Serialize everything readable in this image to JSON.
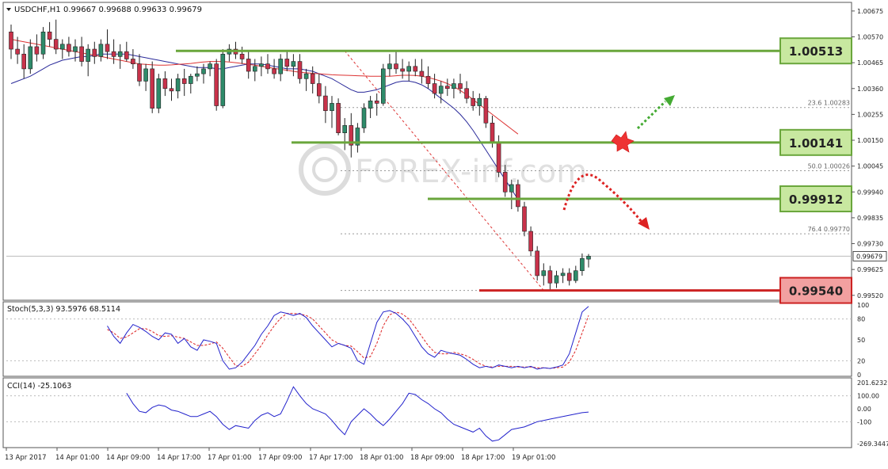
{
  "chart_header": {
    "symbol": "USDCHF,H1",
    "ohlc": "0.99667 0.99688 0.99633 0.99679"
  },
  "watermark": "FOREX-inf.com",
  "levels": [
    {
      "label": "1.00513",
      "value": 1.00513,
      "color": "#6aa63c",
      "fill": "#c8e8a0"
    },
    {
      "label": "1.00141",
      "value": 1.00141,
      "color": "#6aa63c",
      "fill": "#c8e8a0"
    },
    {
      "label": "0.99912",
      "value": 0.99912,
      "color": "#6aa63c",
      "fill": "#c8e8a0"
    },
    {
      "label": "0.99540",
      "value": 0.9954,
      "color": "#cc2222",
      "fill": "#f2a0a0"
    }
  ],
  "fib_labels": [
    {
      "text": "23.6  1.00283",
      "value": 1.00283
    },
    {
      "text": "50.0  1.00026",
      "value": 1.00026
    },
    {
      "text": "76.4  0.99770",
      "value": 0.9977
    }
  ],
  "price_axis": {
    "ticks": [
      "1.00675",
      "1.00570",
      "1.00465",
      "1.00360",
      "1.00255",
      "1.00150",
      "1.00045",
      "0.99940",
      "0.99835",
      "0.99730",
      "0.99625",
      "0.99520"
    ],
    "current": "0.99679"
  },
  "stoch": {
    "label": "Stoch(5,3,3) 93.5976 68.5114",
    "ticks": [
      "100",
      "80",
      "50",
      "20",
      "0"
    ]
  },
  "cci": {
    "label": "CCI(14) -25.1063",
    "ticks": [
      "201.6232",
      "100.00",
      "0.00",
      "-100",
      "-269.3447"
    ]
  },
  "time_axis": [
    "13 Apr 2017",
    "14 Apr 01:00",
    "14 Apr 09:00",
    "14 Apr 17:00",
    "17 Apr 01:00",
    "17 Apr 09:00",
    "17 Apr 17:00",
    "18 Apr 01:00",
    "18 Apr 09:00",
    "18 Apr 17:00",
    "19 Apr 01:00"
  ],
  "colors": {
    "bull": "#2e8b6a",
    "bear": "#c8324a",
    "ma_fast": "#2a2a9a",
    "ma_slow": "#dd3333",
    "stoch_main": "#2222cc",
    "stoch_signal": "#dd2222",
    "cci_line": "#2222cc",
    "arrow_up": "#44aa33",
    "arrow_down": "#dd2222"
  },
  "chart_data": {
    "type": "candlestick",
    "title": "USDCHF,H1",
    "ylim": [
      0.995,
      1.0071
    ],
    "candles": [
      {
        "o": 1.0059,
        "h": 1.0062,
        "l": 1.0048,
        "c": 1.0052
      },
      {
        "o": 1.0052,
        "h": 1.0057,
        "l": 1.0046,
        "c": 1.005
      },
      {
        "o": 1.005,
        "h": 1.0054,
        "l": 1.004,
        "c": 1.0044
      },
      {
        "o": 1.0044,
        "h": 1.0056,
        "l": 1.0042,
        "c": 1.0053
      },
      {
        "o": 1.0053,
        "h": 1.0058,
        "l": 1.0047,
        "c": 1.005
      },
      {
        "o": 1.005,
        "h": 1.0061,
        "l": 1.0048,
        "c": 1.0059
      },
      {
        "o": 1.0059,
        "h": 1.0063,
        "l": 1.0053,
        "c": 1.0056
      },
      {
        "o": 1.0056,
        "h": 1.0064,
        "l": 1.005,
        "c": 1.0052
      },
      {
        "o": 1.0052,
        "h": 1.0056,
        "l": 1.0048,
        "c": 1.0054
      },
      {
        "o": 1.0054,
        "h": 1.0057,
        "l": 1.0049,
        "c": 1.0051
      },
      {
        "o": 1.0051,
        "h": 1.0056,
        "l": 1.0047,
        "c": 1.0053
      },
      {
        "o": 1.0053,
        "h": 1.0057,
        "l": 1.0045,
        "c": 1.0047
      },
      {
        "o": 1.0047,
        "h": 1.0054,
        "l": 1.0041,
        "c": 1.0052
      },
      {
        "o": 1.0052,
        "h": 1.0055,
        "l": 1.0046,
        "c": 1.0049
      },
      {
        "o": 1.0049,
        "h": 1.0056,
        "l": 1.0047,
        "c": 1.0054
      },
      {
        "o": 1.0054,
        "h": 1.006,
        "l": 1.0048,
        "c": 1.0051
      },
      {
        "o": 1.0051,
        "h": 1.0056,
        "l": 1.0046,
        "c": 1.0049
      },
      {
        "o": 1.0049,
        "h": 1.0054,
        "l": 1.0044,
        "c": 1.0051
      },
      {
        "o": 1.0051,
        "h": 1.0055,
        "l": 1.0047,
        "c": 1.0048
      },
      {
        "o": 1.0048,
        "h": 1.0052,
        "l": 1.0044,
        "c": 1.0046
      },
      {
        "o": 1.0046,
        "h": 1.005,
        "l": 1.0037,
        "c": 1.0039
      },
      {
        "o": 1.0039,
        "h": 1.0046,
        "l": 1.0035,
        "c": 1.0044
      },
      {
        "o": 1.0044,
        "h": 1.0047,
        "l": 1.0026,
        "c": 1.0028
      },
      {
        "o": 1.0028,
        "h": 1.0042,
        "l": 1.0026,
        "c": 1.004
      },
      {
        "o": 1.004,
        "h": 1.0043,
        "l": 1.0033,
        "c": 1.0036
      },
      {
        "o": 1.0036,
        "h": 1.004,
        "l": 1.0031,
        "c": 1.0035
      },
      {
        "o": 1.0035,
        "h": 1.0042,
        "l": 1.0032,
        "c": 1.004
      },
      {
        "o": 1.004,
        "h": 1.0044,
        "l": 1.0033,
        "c": 1.0038
      },
      {
        "o": 1.0038,
        "h": 1.0042,
        "l": 1.0034,
        "c": 1.0041
      },
      {
        "o": 1.0041,
        "h": 1.0045,
        "l": 1.0039,
        "c": 1.0042
      },
      {
        "o": 1.0042,
        "h": 1.0046,
        "l": 1.0038,
        "c": 1.0044
      },
      {
        "o": 1.0044,
        "h": 1.0047,
        "l": 1.0041,
        "c": 1.0046
      },
      {
        "o": 1.0046,
        "h": 1.0048,
        "l": 1.0027,
        "c": 1.0029
      },
      {
        "o": 1.0029,
        "h": 1.0052,
        "l": 1.0028,
        "c": 1.005
      },
      {
        "o": 1.005,
        "h": 1.0054,
        "l": 1.0047,
        "c": 1.0052
      },
      {
        "o": 1.0052,
        "h": 1.0055,
        "l": 1.0048,
        "c": 1.005
      },
      {
        "o": 1.005,
        "h": 1.0053,
        "l": 1.0046,
        "c": 1.0048
      },
      {
        "o": 1.0048,
        "h": 1.0051,
        "l": 1.004,
        "c": 1.0043
      },
      {
        "o": 1.0043,
        "h": 1.0048,
        "l": 1.0039,
        "c": 1.0045
      },
      {
        "o": 1.0045,
        "h": 1.0049,
        "l": 1.0041,
        "c": 1.0046
      },
      {
        "o": 1.0046,
        "h": 1.005,
        "l": 1.0042,
        "c": 1.0044
      },
      {
        "o": 1.0044,
        "h": 1.0048,
        "l": 1.004,
        "c": 1.0042
      },
      {
        "o": 1.0042,
        "h": 1.005,
        "l": 1.0039,
        "c": 1.0048
      },
      {
        "o": 1.0048,
        "h": 1.0051,
        "l": 1.0043,
        "c": 1.0045
      },
      {
        "o": 1.0045,
        "h": 1.005,
        "l": 1.0041,
        "c": 1.0047
      },
      {
        "o": 1.0047,
        "h": 1.005,
        "l": 1.0038,
        "c": 1.004
      },
      {
        "o": 1.004,
        "h": 1.0044,
        "l": 1.0035,
        "c": 1.0042
      },
      {
        "o": 1.0042,
        "h": 1.0045,
        "l": 1.0034,
        "c": 1.0038
      },
      {
        "o": 1.0038,
        "h": 1.0042,
        "l": 1.003,
        "c": 1.0033
      },
      {
        "o": 1.0033,
        "h": 1.0037,
        "l": 1.0022,
        "c": 1.0027
      },
      {
        "o": 1.0027,
        "h": 1.0033,
        "l": 1.002,
        "c": 1.003
      },
      {
        "o": 1.003,
        "h": 1.0032,
        "l": 1.0017,
        "c": 1.0018
      },
      {
        "o": 1.0018,
        "h": 1.0024,
        "l": 1.0011,
        "c": 1.0021
      },
      {
        "o": 1.0021,
        "h": 1.0026,
        "l": 1.0008,
        "c": 1.0013
      },
      {
        "o": 1.0013,
        "h": 1.0022,
        "l": 1.001,
        "c": 1.002
      },
      {
        "o": 1.002,
        "h": 1.003,
        "l": 1.0018,
        "c": 1.0028
      },
      {
        "o": 1.0028,
        "h": 1.0033,
        "l": 1.0024,
        "c": 1.0031
      },
      {
        "o": 1.0031,
        "h": 1.0034,
        "l": 1.0025,
        "c": 1.003
      },
      {
        "o": 1.003,
        "h": 1.0046,
        "l": 1.0029,
        "c": 1.0044
      },
      {
        "o": 1.0044,
        "h": 1.005,
        "l": 1.0041,
        "c": 1.0046
      },
      {
        "o": 1.0046,
        "h": 1.0051,
        "l": 1.0042,
        "c": 1.0044
      },
      {
        "o": 1.0044,
        "h": 1.0048,
        "l": 1.004,
        "c": 1.0043
      },
      {
        "o": 1.0043,
        "h": 1.0047,
        "l": 1.0039,
        "c": 1.0045
      },
      {
        "o": 1.0045,
        "h": 1.0048,
        "l": 1.0041,
        "c": 1.0043
      },
      {
        "o": 1.0043,
        "h": 1.0048,
        "l": 1.0038,
        "c": 1.0041
      },
      {
        "o": 1.0041,
        "h": 1.0045,
        "l": 1.0036,
        "c": 1.0038
      },
      {
        "o": 1.0038,
        "h": 1.0042,
        "l": 1.0032,
        "c": 1.0034
      },
      {
        "o": 1.0034,
        "h": 1.0039,
        "l": 1.003,
        "c": 1.0037
      },
      {
        "o": 1.0037,
        "h": 1.004,
        "l": 1.0033,
        "c": 1.0036
      },
      {
        "o": 1.0036,
        "h": 1.004,
        "l": 1.0032,
        "c": 1.0038
      },
      {
        "o": 1.0038,
        "h": 1.0042,
        "l": 1.0034,
        "c": 1.0036
      },
      {
        "o": 1.0036,
        "h": 1.0039,
        "l": 1.003,
        "c": 1.0032
      },
      {
        "o": 1.0032,
        "h": 1.0035,
        "l": 1.0027,
        "c": 1.0029
      },
      {
        "o": 1.0029,
        "h": 1.0034,
        "l": 1.0025,
        "c": 1.0032
      },
      {
        "o": 1.0032,
        "h": 1.0033,
        "l": 1.002,
        "c": 1.0022
      },
      {
        "o": 1.0022,
        "h": 1.0025,
        "l": 1.0012,
        "c": 1.0014
      },
      {
        "o": 1.0014,
        "h": 1.0017,
        "l": 1.0,
        "c": 1.0002
      },
      {
        "o": 1.0002,
        "h": 1.0005,
        "l": 0.9992,
        "c": 0.9994
      },
      {
        "o": 0.9994,
        "h": 0.9999,
        "l": 0.9987,
        "c": 0.9997
      },
      {
        "o": 0.9997,
        "h": 0.9999,
        "l": 0.9986,
        "c": 0.9988
      },
      {
        "o": 0.9988,
        "h": 0.999,
        "l": 0.9976,
        "c": 0.9978
      },
      {
        "o": 0.9978,
        "h": 0.998,
        "l": 0.9968,
        "c": 0.997
      },
      {
        "o": 0.997,
        "h": 0.9972,
        "l": 0.9958,
        "c": 0.996
      },
      {
        "o": 0.996,
        "h": 0.9965,
        "l": 0.9956,
        "c": 0.9962
      },
      {
        "o": 0.9962,
        "h": 0.9964,
        "l": 0.9954,
        "c": 0.9957
      },
      {
        "o": 0.9957,
        "h": 0.9962,
        "l": 0.9955,
        "c": 0.996
      },
      {
        "o": 0.996,
        "h": 0.9963,
        "l": 0.9957,
        "c": 0.9961
      },
      {
        "o": 0.9961,
        "h": 0.9963,
        "l": 0.9956,
        "c": 0.9958
      },
      {
        "o": 0.9958,
        "h": 0.9964,
        "l": 0.9957,
        "c": 0.9962
      },
      {
        "o": 0.9962,
        "h": 0.9969,
        "l": 0.996,
        "c": 0.9967
      },
      {
        "o": 0.99667,
        "h": 0.99688,
        "l": 0.99633,
        "c": 0.99679
      }
    ],
    "ma_fast": [
      1.0038,
      1.0039,
      1.004,
      1.0041,
      1.00425,
      1.0044,
      1.00455,
      1.00465,
      1.00475,
      1.0048,
      1.00485,
      1.0049,
      1.0049,
      1.00495,
      1.005,
      1.005,
      1.005,
      1.005,
      1.005,
      1.00495,
      1.0049,
      1.00485,
      1.0048,
      1.00475,
      1.0047,
      1.00465,
      1.0046,
      1.00455,
      1.0045,
      1.00445,
      1.00445,
      1.00445,
      1.0044,
      1.0044,
      1.00445,
      1.0045,
      1.00455,
      1.0046,
      1.0046,
      1.0046,
      1.00455,
      1.0045,
      1.00445,
      1.0044,
      1.0044,
      1.0044,
      1.00435,
      1.0043,
      1.0042,
      1.0041,
      1.004,
      1.00385,
      1.0037,
      1.00355,
      1.00345,
      1.00345,
      1.0035,
      1.00355,
      1.00365,
      1.00375,
      1.00385,
      1.0039,
      1.0039,
      1.00385,
      1.00375,
      1.0036,
      1.0034,
      1.0032,
      1.003,
      1.0028,
      1.00255,
      1.00225,
      1.0019,
      1.0015,
      1.0011,
      1.0007,
      1.0003,
      0.9999,
      0.9995,
      0.9991
    ],
    "ma_slow": [
      1.0056,
      1.00555,
      1.0055,
      1.00545,
      1.0054,
      1.00535,
      1.0053,
      1.00525,
      1.0052,
      1.00515,
      1.0051,
      1.00505,
      1.005,
      1.00495,
      1.0049,
      1.00485,
      1.0048,
      1.00475,
      1.0047,
      1.00465,
      1.0046,
      1.00458,
      1.00456,
      1.00455,
      1.00455,
      1.00456,
      1.00458,
      1.0046,
      1.00462,
      1.00465,
      1.00468,
      1.0047,
      1.0047,
      1.0047,
      1.00468,
      1.00465,
      1.00462,
      1.00458,
      1.00455,
      1.0045,
      1.00446,
      1.00442,
      1.00438,
      1.00434,
      1.0043,
      1.00426,
      1.00424,
      1.00422,
      1.0042,
      1.00418,
      1.00416,
      1.00415,
      1.00414,
      1.00413,
      1.00412,
      1.00411,
      1.0041,
      1.0041,
      1.0041,
      1.0041,
      1.00412,
      1.00414,
      1.00414,
      1.00413,
      1.0041,
      1.00405,
      1.00398,
      1.0039,
      1.0038,
      1.00368,
      1.00352,
      1.00335,
      1.00315,
      1.00295,
      1.00275,
      1.00255,
      1.00235,
      1.00215,
      1.00195,
      1.00175
    ],
    "stoch_main": [
      70,
      55,
      45,
      60,
      72,
      68,
      62,
      55,
      50,
      60,
      58,
      45,
      52,
      40,
      35,
      50,
      48,
      45,
      20,
      8,
      10,
      18,
      30,
      42,
      58,
      70,
      85,
      90,
      88,
      85,
      88,
      82,
      70,
      60,
      50,
      40,
      45,
      42,
      38,
      20,
      15,
      45,
      75,
      90,
      92,
      88,
      80,
      70,
      55,
      40,
      30,
      25,
      35,
      32,
      30,
      28,
      22,
      15,
      10,
      12,
      10,
      14,
      12,
      10,
      12,
      10,
      12,
      8,
      10,
      9,
      11,
      14,
      30,
      60,
      90,
      98
    ],
    "stoch_signal": [
      65,
      60,
      52,
      54,
      60,
      66,
      66,
      62,
      56,
      55,
      56,
      54,
      52,
      47,
      42,
      42,
      44,
      47,
      38,
      25,
      13,
      12,
      18,
      30,
      42,
      57,
      70,
      81,
      88,
      88,
      87,
      85,
      80,
      70,
      60,
      50,
      45,
      42,
      41,
      33,
      24,
      26,
      45,
      70,
      86,
      90,
      87,
      80,
      68,
      55,
      42,
      32,
      30,
      30,
      32,
      30,
      27,
      22,
      16,
      12,
      11,
      12,
      12,
      12,
      11,
      11,
      11,
      10,
      10,
      9,
      10,
      11,
      18,
      35,
      60,
      85
    ],
    "cci": [
      120,
      40,
      -20,
      -30,
      10,
      30,
      20,
      -10,
      -20,
      -40,
      -60,
      -60,
      -40,
      -20,
      -60,
      -120,
      -160,
      -130,
      -140,
      -150,
      -90,
      -50,
      -30,
      -60,
      -40,
      60,
      170,
      100,
      40,
      0,
      -20,
      -40,
      -90,
      -150,
      -200,
      -100,
      -50,
      0,
      -40,
      -90,
      -130,
      -80,
      -20,
      40,
      120,
      110,
      70,
      40,
      0,
      -30,
      -80,
      -120,
      -140,
      -160,
      -180,
      -150,
      -210,
      -250,
      -240,
      -200,
      -160,
      -150,
      -140,
      -120,
      -100,
      -90,
      -80,
      -70,
      -60,
      -50,
      -40,
      -30,
      -25
    ]
  }
}
